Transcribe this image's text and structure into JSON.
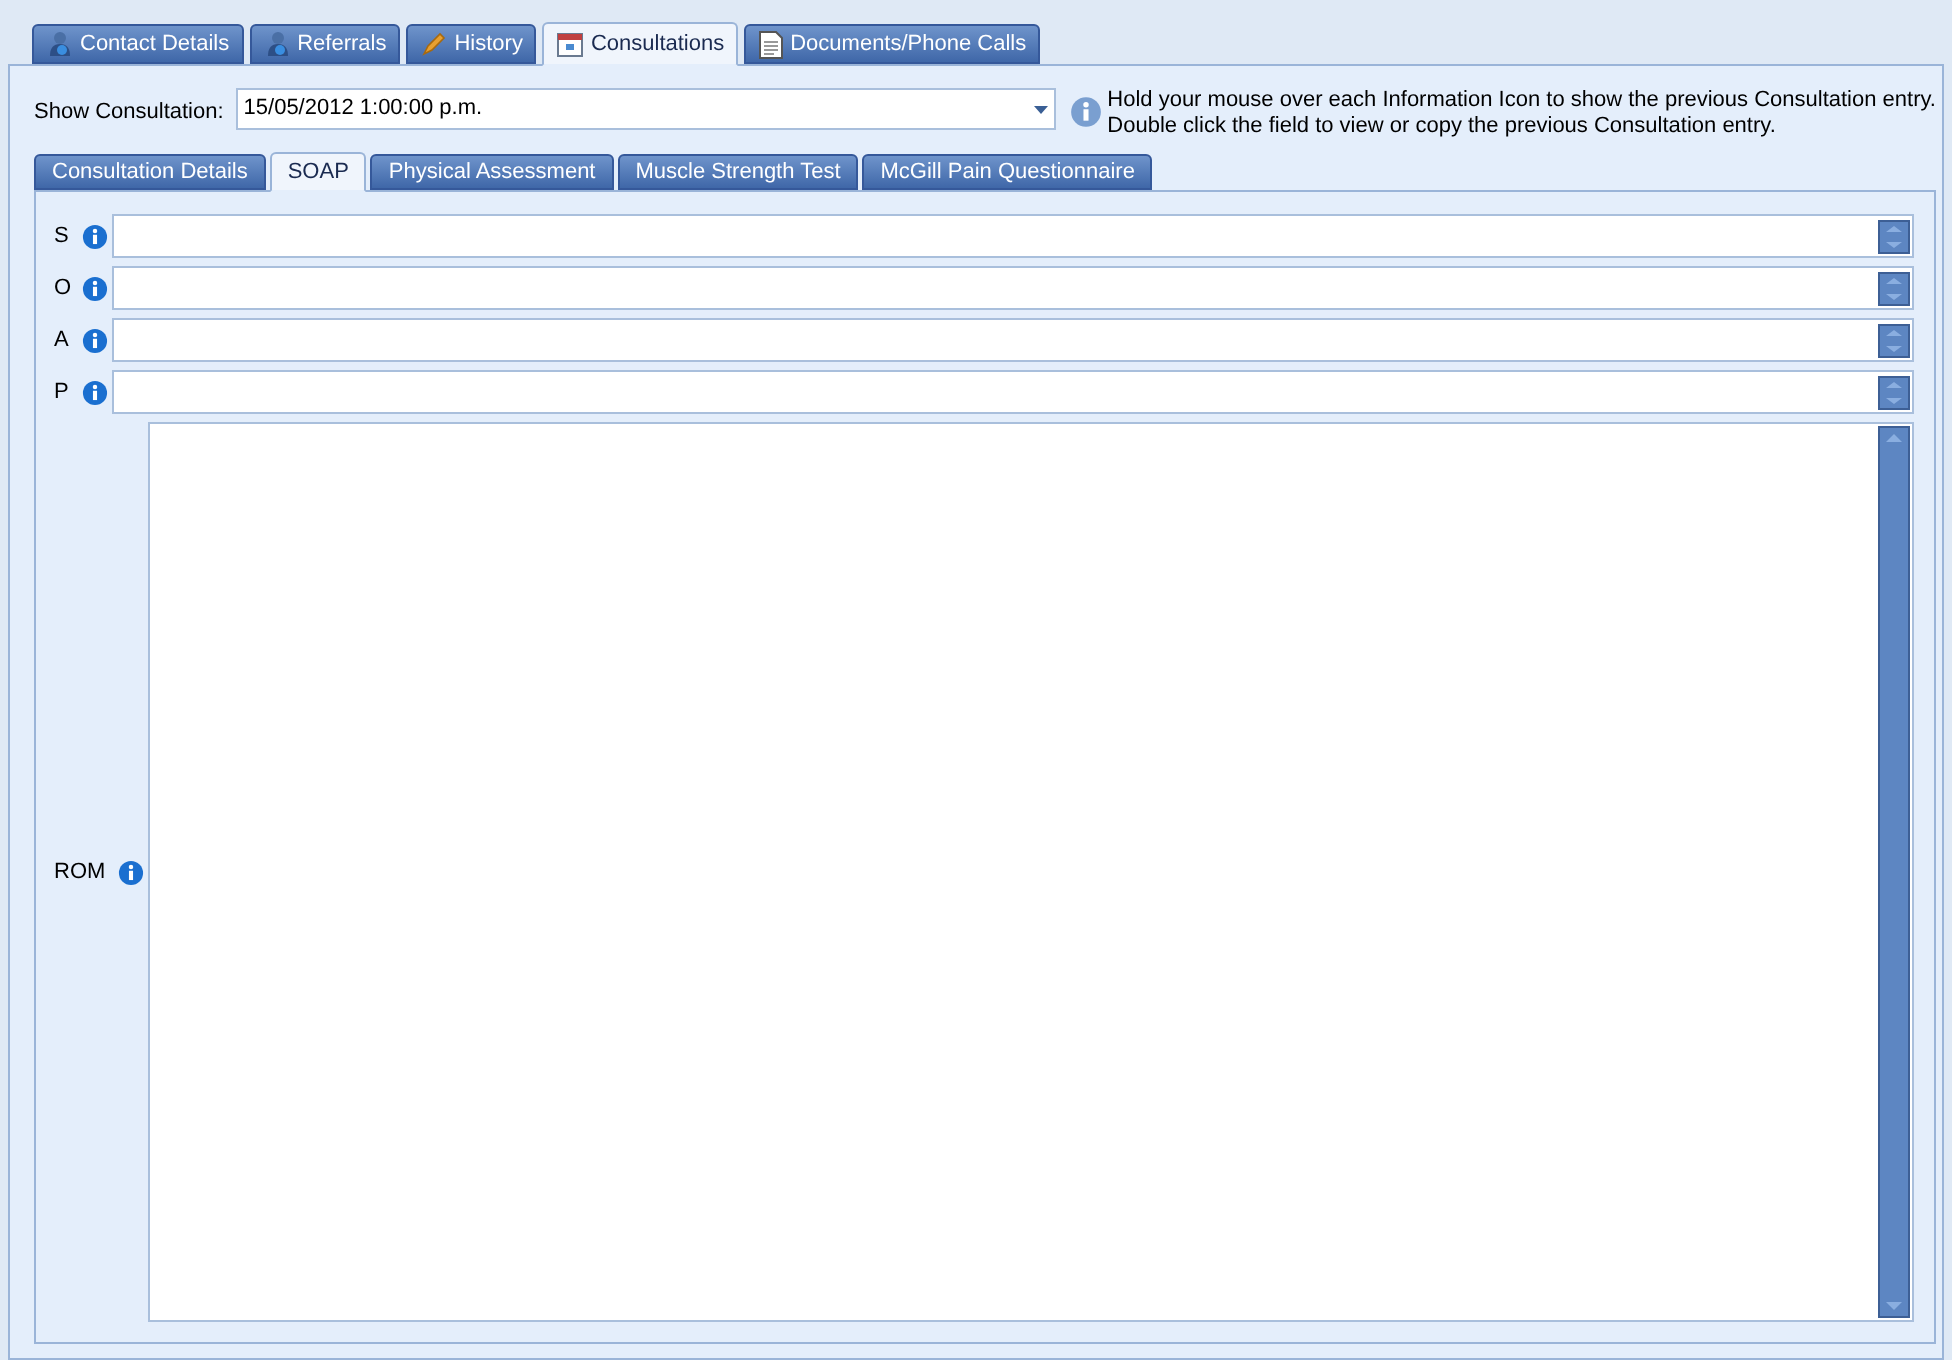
{
  "tabs": [
    {
      "label": "Contact Details",
      "selected": false
    },
    {
      "label": "Referrals",
      "selected": false
    },
    {
      "label": "History",
      "selected": false
    },
    {
      "label": "Consultations",
      "selected": true
    },
    {
      "label": "Documents/Phone Calls",
      "selected": false
    }
  ],
  "show_consultation": {
    "label": "Show Consultation:",
    "value": "15/05/2012 1:00:00 p.m."
  },
  "info_text": "Hold your mouse over each Information Icon to show the previous Consultation entry.\nDouble click the field to view or copy the previous Consultation entry.",
  "subtabs": [
    {
      "label": "Consultation Details",
      "selected": false
    },
    {
      "label": "SOAP",
      "selected": true
    },
    {
      "label": "Physical Assessment",
      "selected": false
    },
    {
      "label": "Muscle Strength Test",
      "selected": false
    },
    {
      "label": "McGill Pain Questionnaire",
      "selected": false
    }
  ],
  "fields": [
    {
      "label": "S",
      "kind": "line"
    },
    {
      "label": "O",
      "kind": "line"
    },
    {
      "label": "A",
      "kind": "line"
    },
    {
      "label": "P",
      "kind": "line"
    },
    {
      "label": "ROM",
      "kind": "area"
    }
  ]
}
